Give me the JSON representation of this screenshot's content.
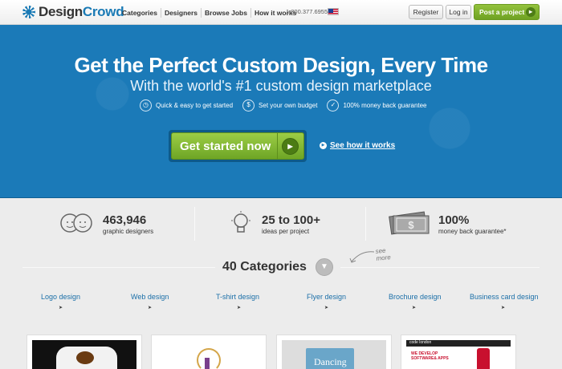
{
  "header": {
    "logo_text_1": "Design",
    "logo_text_2": "Crowd",
    "nav": [
      "Categories",
      "Designers",
      "Browse Jobs",
      "How it works"
    ],
    "phone": "1.800.377.6955",
    "register_label": "Register",
    "login_label": "Log in",
    "post_label": "Post a project"
  },
  "hero": {
    "title": "Get the Perfect Custom Design, Every Time",
    "subtitle": "With the world's #1 custom design marketplace",
    "features": [
      {
        "icon": "clock-icon",
        "text": "Quick & easy to get started"
      },
      {
        "icon": "dollar-icon",
        "text": "Set your own budget"
      },
      {
        "icon": "check-icon",
        "text": "100% money back guarantee"
      }
    ],
    "cta_label": "Get started now",
    "see_how_label": "See how it works"
  },
  "stats": [
    {
      "icon": "designers-icon",
      "value": "463,946",
      "label": "graphic designers"
    },
    {
      "icon": "lightbulb-icon",
      "value": "25 to 100+",
      "label": "ideas per project"
    },
    {
      "icon": "money-icon",
      "value": "100%",
      "label": "money back guarantee*"
    }
  ],
  "categories": {
    "title": "40 Categories",
    "see_more_1": "see",
    "see_more_2": "more",
    "items": [
      "Logo design",
      "Web design",
      "T-shirt design",
      "Flyer design",
      "Brochure design",
      "Business card design"
    ]
  },
  "thumbnails": {
    "book_title": "Dancing",
    "promo_bar": "code london",
    "promo_1": "WE DEVELOP",
    "promo_2": "SOFTWARE& APPS"
  },
  "colors": {
    "brand_blue": "#1b7ab8",
    "cta_green": "#7fb52f",
    "link_blue": "#1b6fa8"
  }
}
